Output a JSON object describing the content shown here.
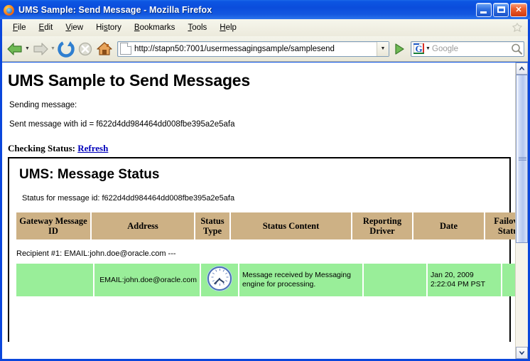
{
  "window": {
    "title": "UMS Sample: Send Message - Mozilla Firefox",
    "favicon": "firefox-icon",
    "controls": {
      "minimize": "minimize-button",
      "maximize": "maximize-button",
      "close": "close-button",
      "close_glyph": "✕"
    }
  },
  "menubar": {
    "items": [
      {
        "label": "File",
        "accesskey": "F"
      },
      {
        "label": "Edit",
        "accesskey": "E"
      },
      {
        "label": "View",
        "accesskey": "V"
      },
      {
        "label": "History",
        "accesskey": "s"
      },
      {
        "label": "Bookmarks",
        "accesskey": "B"
      },
      {
        "label": "Tools",
        "accesskey": "T"
      },
      {
        "label": "Help",
        "accesskey": "H"
      }
    ]
  },
  "toolbar": {
    "back": "back-arrow-icon",
    "forward": "forward-arrow-icon",
    "reload": "reload-icon",
    "stop": "stop-icon",
    "home": "home-icon",
    "go": "go-arrow-icon",
    "caret": "▼",
    "url": {
      "value": "http://stapn50:7001/usermessagingsample/samplesend",
      "page_icon": "page-icon",
      "dropdown": "▼"
    },
    "search": {
      "engine": "Google",
      "engine_letter": "G",
      "placeholder": "Google",
      "dropdown": "▼",
      "magnifier": "magnifier-icon"
    }
  },
  "page": {
    "heading": "UMS Sample to Send Messages",
    "sending_line": "Sending message:",
    "sent_line": "Sent message with id = f622d4dd984464dd008fbe395a2e5afa",
    "checking_label": "Checking Status:",
    "refresh_link": "Refresh",
    "status_panel": {
      "heading": "UMS: Message Status",
      "status_for": "Status for message id: f622d4dd984464dd008fbe395a2e5afa",
      "recipient_line": "Recipient #1: EMAIL:john.doe@oracle.com ---",
      "columns": [
        "Gateway Message ID",
        "Address",
        "Status Type",
        "Status Content",
        "Reporting Driver",
        "Date",
        "Failover Status"
      ],
      "rows": [
        {
          "gateway_message_id": "",
          "address": "EMAIL:john.doe@oracle.com",
          "status_type_icon": "clock-icon",
          "status_content": "Message received by Messaging engine for processing.",
          "reporting_driver": "",
          "date_line1": "Jan 20, 2009",
          "date_line2": "2:22:04 PM PST",
          "failover_status": "false"
        }
      ]
    }
  },
  "scrollbar": {
    "up": "▲",
    "down": "▼"
  },
  "colors": {
    "titlebar_blue": "#0b4ddc",
    "header_tan": "#cdb185",
    "row_green": "#99ee99",
    "link_blue": "#0000bb"
  }
}
